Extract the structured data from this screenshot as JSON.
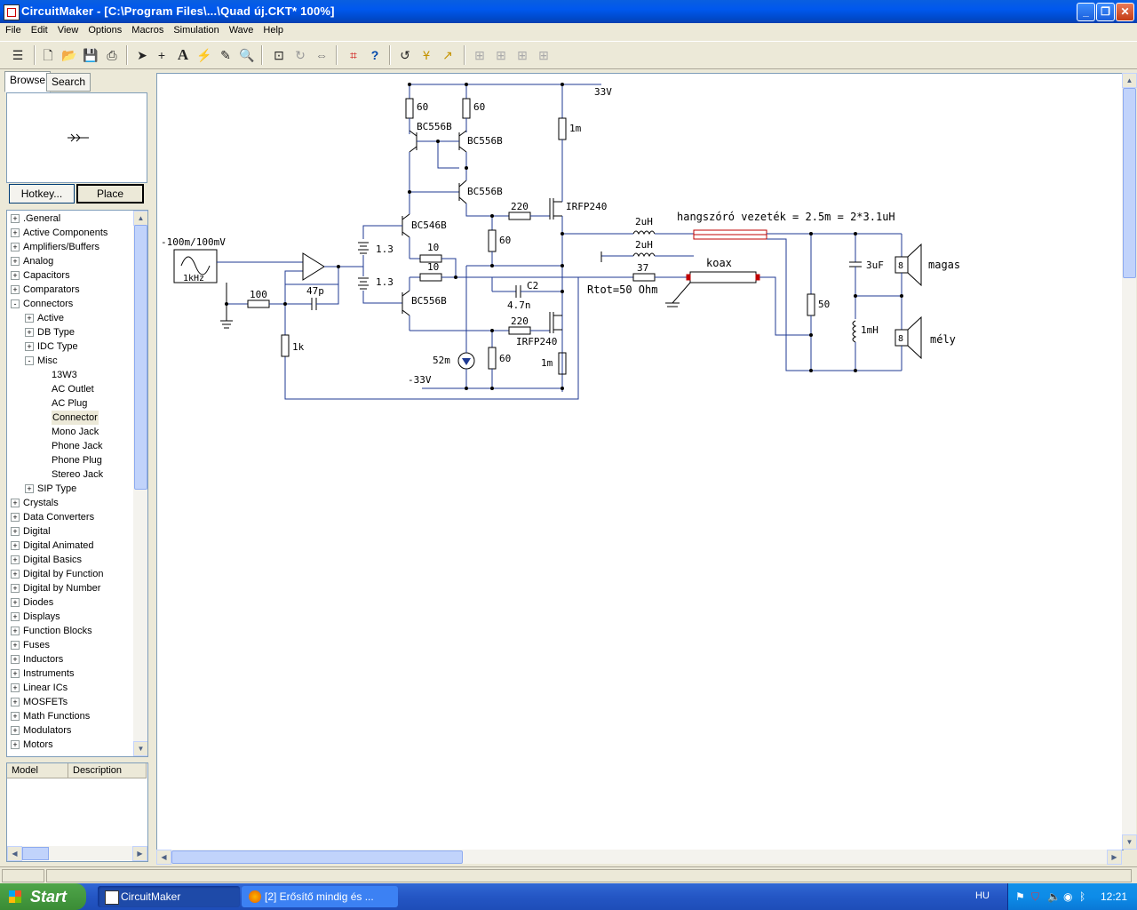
{
  "window": {
    "title": "CircuitMaker - [C:\\Program Files\\...\\Quad új.CKT* 100%]"
  },
  "menu": [
    "File",
    "Edit",
    "View",
    "Options",
    "Macros",
    "Simulation",
    "Wave",
    "Help"
  ],
  "left_panel": {
    "tabs": [
      "Browse",
      "Search"
    ],
    "hotkey_label": "Hotkey...",
    "place_label": "Place",
    "tree": [
      {
        "label": ".General",
        "level": 0,
        "expander": "+"
      },
      {
        "label": "Active Components",
        "level": 0,
        "expander": "+"
      },
      {
        "label": "Amplifiers/Buffers",
        "level": 0,
        "expander": "+"
      },
      {
        "label": "Analog",
        "level": 0,
        "expander": "+"
      },
      {
        "label": "Capacitors",
        "level": 0,
        "expander": "+"
      },
      {
        "label": "Comparators",
        "level": 0,
        "expander": "+"
      },
      {
        "label": "Connectors",
        "level": 0,
        "expander": "-"
      },
      {
        "label": "Active",
        "level": 1,
        "expander": "+"
      },
      {
        "label": "DB Type",
        "level": 1,
        "expander": "+"
      },
      {
        "label": "IDC Type",
        "level": 1,
        "expander": "+"
      },
      {
        "label": "Misc",
        "level": 1,
        "expander": "-"
      },
      {
        "label": "13W3",
        "level": 2,
        "expander": ""
      },
      {
        "label": "AC Outlet",
        "level": 2,
        "expander": ""
      },
      {
        "label": "AC Plug",
        "level": 2,
        "expander": ""
      },
      {
        "label": "Connector",
        "level": 2,
        "expander": "",
        "selected": true
      },
      {
        "label": "Mono Jack",
        "level": 2,
        "expander": ""
      },
      {
        "label": "Phone Jack",
        "level": 2,
        "expander": ""
      },
      {
        "label": "Phone Plug",
        "level": 2,
        "expander": ""
      },
      {
        "label": "Stereo Jack",
        "level": 2,
        "expander": ""
      },
      {
        "label": "SIP Type",
        "level": 1,
        "expander": "+"
      },
      {
        "label": "Crystals",
        "level": 0,
        "expander": "+"
      },
      {
        "label": "Data Converters",
        "level": 0,
        "expander": "+"
      },
      {
        "label": "Digital",
        "level": 0,
        "expander": "+"
      },
      {
        "label": "Digital Animated",
        "level": 0,
        "expander": "+"
      },
      {
        "label": "Digital Basics",
        "level": 0,
        "expander": "+"
      },
      {
        "label": "Digital by Function",
        "level": 0,
        "expander": "+"
      },
      {
        "label": "Digital by Number",
        "level": 0,
        "expander": "+"
      },
      {
        "label": "Diodes",
        "level": 0,
        "expander": "+"
      },
      {
        "label": "Displays",
        "level": 0,
        "expander": "+"
      },
      {
        "label": "Function Blocks",
        "level": 0,
        "expander": "+"
      },
      {
        "label": "Fuses",
        "level": 0,
        "expander": "+"
      },
      {
        "label": "Inductors",
        "level": 0,
        "expander": "+"
      },
      {
        "label": "Instruments",
        "level": 0,
        "expander": "+"
      },
      {
        "label": "Linear ICs",
        "level": 0,
        "expander": "+"
      },
      {
        "label": "MOSFETs",
        "level": 0,
        "expander": "+"
      },
      {
        "label": "Math Functions",
        "level": 0,
        "expander": "+"
      },
      {
        "label": "Modulators",
        "level": 0,
        "expander": "+"
      },
      {
        "label": "Motors",
        "level": 0,
        "expander": "+"
      }
    ],
    "model_columns": [
      "Model",
      "Description"
    ]
  },
  "schematic": {
    "supply_pos": "33V",
    "supply_neg": "-33V",
    "source_amplitude": "-100m/100mV",
    "source_freq": "1kHz",
    "r_in": "100",
    "c_fb": "47p",
    "r_fb": "1k",
    "r_top1": "60",
    "r_top2": "60",
    "r_1m_top": "1m",
    "q1": "BC556B",
    "q2": "BC556B",
    "q3": "BC556B",
    "q4": "BC546B",
    "q5": "BC556B",
    "batt1": "1.3",
    "batt2": "1.3",
    "r10a": "10",
    "r10b": "10",
    "r220a": "220",
    "r220b": "220",
    "r60mid": "60",
    "r60low": "60",
    "m1": "IRFP240",
    "m2": "IRFP240",
    "c2_name": "C2",
    "c2_val": "4.7n",
    "isrc": "52m",
    "r_1m_bot": "1m",
    "l1": "2uH",
    "l2": "2uH",
    "r37": "37",
    "cable_label": "hangszóró vezeték = 2.5m = 2*3.1uH",
    "koax": "koax",
    "rtot": "Rtot=50 Ohm",
    "r50": "50",
    "c3": "3uF",
    "l3": "1mH",
    "spk1_imp": "8",
    "spk2_imp": "8",
    "spk1": "magas",
    "spk2": "mély"
  },
  "taskbar": {
    "start": "Start",
    "tasks": [
      "CircuitMaker",
      "[2] Erősítő mindig és ..."
    ],
    "lang": "HU",
    "clock": "12:21"
  }
}
